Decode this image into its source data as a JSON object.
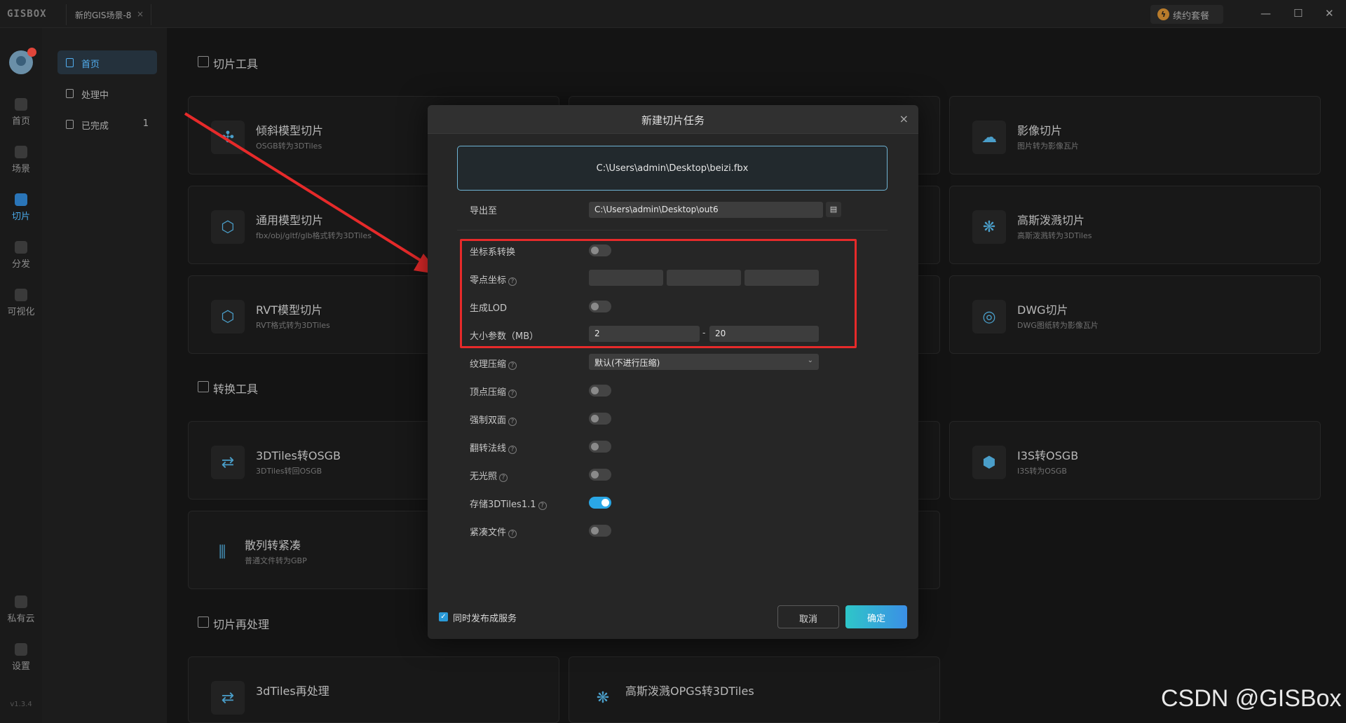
{
  "titlebar": {
    "logo": "GISBOX",
    "tab_title": "新的GIS场景-8",
    "tab_close": "×",
    "renew_label": "续约套餐",
    "minimize": "—",
    "maximize": "☐",
    "close": "✕"
  },
  "rail": {
    "items": [
      {
        "label": "首页",
        "icon": "home-icon"
      },
      {
        "label": "场景",
        "icon": "scene-icon"
      },
      {
        "label": "切片",
        "icon": "tile-icon"
      },
      {
        "label": "分发",
        "icon": "distribute-icon"
      },
      {
        "label": "可视化",
        "icon": "visual-icon"
      },
      {
        "label": "私有云",
        "icon": "cloud-lock-icon"
      },
      {
        "label": "设置",
        "icon": "gear-icon"
      }
    ],
    "active": "切片",
    "version": "v1.3.4"
  },
  "sidebar": {
    "items": [
      {
        "label": "首页",
        "count": ""
      },
      {
        "label": "处理中",
        "count": ""
      },
      {
        "label": "已完成",
        "count": "1"
      }
    ]
  },
  "sections": {
    "tiling": "切片工具",
    "convert": "转换工具",
    "post": "切片再处理"
  },
  "cards": {
    "oblique": {
      "title": "倾斜模型切片",
      "sub": "OSGB转为3DTiles"
    },
    "generic": {
      "title": "通用模型切片",
      "sub": "fbx/obj/gltf/glb格式转为3DTiles"
    },
    "rvt": {
      "title": "RVT模型切片",
      "sub": "RVT格式转为3DTiles"
    },
    "image": {
      "title": "影像切片",
      "sub": "图片转为影像瓦片"
    },
    "gauss": {
      "title": "高斯泼溅切片",
      "sub": "高斯泼溅转为3DTiles"
    },
    "dwg": {
      "title": "DWG切片",
      "sub": "DWG图纸转为影像瓦片"
    },
    "tiles2osgb": {
      "title": "3DTiles转OSGB",
      "sub": "3DTiles转回OSGB"
    },
    "i3s": {
      "title": "I3S转OSGB",
      "sub": "I3S转为OSGB"
    },
    "scatter": {
      "title": "散列转紧凑",
      "sub": "普通文件转为GBP"
    },
    "reprocess": {
      "title": "3dTiles再处理",
      "sub": ""
    },
    "opgs": {
      "title": "高斯泼溅OPGS转3DTiles",
      "sub": ""
    }
  },
  "dialog": {
    "title": "新建切片任务",
    "close": "×",
    "file_path": "C:\\Users\\admin\\Desktop\\beizi.fbx",
    "export_label": "导出至",
    "export_path": "C:\\Users\\admin\\Desktop\\out6",
    "crs_label": "坐标系转换",
    "crs_on": false,
    "origin_label": "零点坐标",
    "origin_values": [
      "",
      "",
      ""
    ],
    "lod_label": "生成LOD",
    "lod_on": false,
    "size_label": "大小参数（MB）",
    "size_min": "2",
    "size_sep": "-",
    "size_max": "20",
    "texture_label": "纹理压缩",
    "texture_value": "默认(不进行压缩)",
    "vertex_label": "顶点压缩",
    "vertex_on": false,
    "double_label": "强制双面",
    "double_on": false,
    "flip_label": "翻转法线",
    "flip_on": false,
    "unlit_label": "无光照",
    "unlit_on": false,
    "tiles11_label": "存储3DTiles1.1",
    "tiles11_on": true,
    "compact_label": "紧凑文件",
    "compact_on": false,
    "publish_label": "同时发布成服务",
    "publish_checked": true,
    "cancel": "取消",
    "ok": "确定",
    "help_glyph": "?"
  },
  "watermark": "CSDN @GISBox",
  "colors": {
    "accent": "#2aa7e6",
    "highlight_box": "#e62a2a"
  }
}
